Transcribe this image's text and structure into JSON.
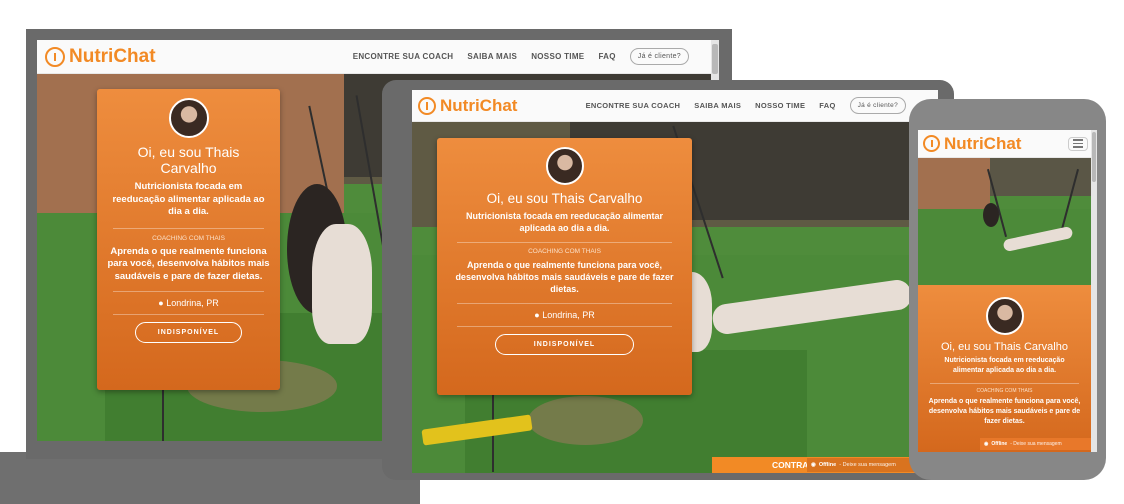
{
  "brand": {
    "name": "NutriChat",
    "color": "#f28a25"
  },
  "nav": {
    "items": [
      "ENCONTRE SUA COACH",
      "SAIBA MAIS",
      "NOSSO TIME",
      "FAQ"
    ],
    "client_button": "Já é cliente?"
  },
  "coach": {
    "greeting_short": "Oi, eu sou Thais Carvalho",
    "greeting_long": "Oi, eu sou Thais Carvalho",
    "tagline": "Nutricionista focada em reeducação alimentar aplicada ao dia a dia.",
    "section_label": "COACHING COM THAIS",
    "pitch": "Aprenda o que realmente funciona para você, desenvolva hábitos mais saudáveis e pare de fazer dietas.",
    "location": "Londrina, PR",
    "button": "INDISPONÍVEL"
  },
  "chat": {
    "status": "Offline",
    "message": "- Deixe sua mensagem"
  },
  "contract_tab": "CONTRA",
  "icons": {
    "location": "map-marker-icon",
    "menu": "hamburger-icon",
    "chat": "chat-bubble-icon",
    "logo": "spoon-bubble-icon"
  }
}
